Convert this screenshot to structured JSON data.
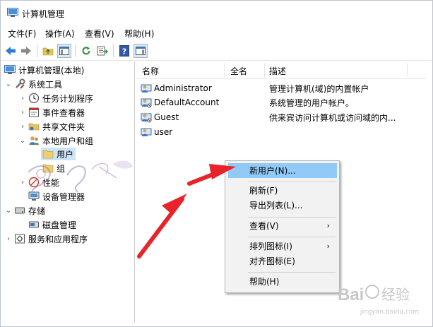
{
  "window": {
    "title": "计算机管理"
  },
  "menu": [
    "文件(F)",
    "操作(A)",
    "查看(V)",
    "帮助(H)"
  ],
  "tree": {
    "root": "计算机管理(本地)",
    "system_tools": "系统工具",
    "task_scheduler": "任务计划程序",
    "event_viewer": "事件查看器",
    "shared_folders": "共享文件夹",
    "local_users_groups": "本地用户和组",
    "users": "用户",
    "groups": "组",
    "performance": "性能",
    "device_manager": "设备管理器",
    "storage": "存储",
    "disk_management": "磁盘管理",
    "services_apps": "服务和应用程序"
  },
  "list": {
    "columns": [
      "名称",
      "全名",
      "描述"
    ],
    "rows": [
      {
        "name": "Administrator",
        "fullname": "",
        "desc": "管理计算机(域)的内置帐户"
      },
      {
        "name": "DefaultAccount",
        "fullname": "",
        "desc": "系统管理的用户帐户。"
      },
      {
        "name": "Guest",
        "fullname": "",
        "desc": "供来宾访问计算机或访问域的内..."
      },
      {
        "name": "user",
        "fullname": "",
        "desc": ""
      }
    ]
  },
  "context_menu": {
    "new_user": "新用户(N)...",
    "refresh": "刷新(F)",
    "export_list": "导出列表(L)...",
    "view": "查看(V)",
    "arrange_icons": "排列图标(I)",
    "line_up_icons": "对齐图标(E)",
    "help": "帮助(H)"
  },
  "watermark": {
    "brand": "Bai",
    "brand_suffix": "经验",
    "url": "jingyan.baidu.com"
  },
  "colors": {
    "arrow": "#e8232a",
    "highlight": "#91c9f7",
    "selection": "#cce4f7"
  }
}
